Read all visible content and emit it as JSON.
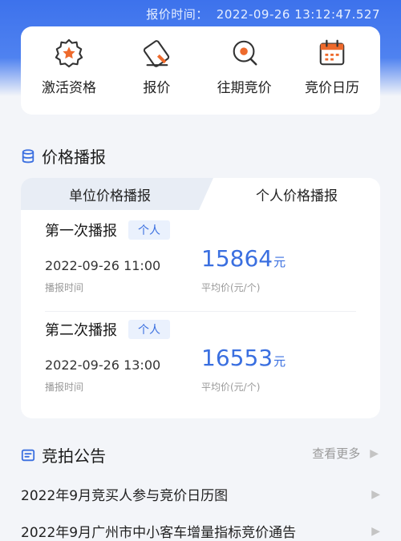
{
  "header": {
    "time_label": "报价时间：",
    "time_value": "2022-09-26 13:12:47.527"
  },
  "quick_links": [
    {
      "label": "激活资格",
      "icon": "badge-star-icon"
    },
    {
      "label": "报价",
      "icon": "pen-edit-icon"
    },
    {
      "label": "往期竞价",
      "icon": "search-history-icon"
    },
    {
      "label": "竞价日历",
      "icon": "calendar-icon"
    }
  ],
  "price_section": {
    "title": "价格播报",
    "tabs": [
      "单位价格播报",
      "个人价格播报"
    ],
    "active_tab": 1,
    "records": [
      {
        "title": "第一次播报",
        "tag": "个人",
        "time": "2022-09-26 11:00",
        "time_label": "播报时间",
        "price": "15864",
        "unit": "元",
        "price_label": "平均价(元/个)"
      },
      {
        "title": "第二次播报",
        "tag": "个人",
        "time": "2022-09-26 13:00",
        "time_label": "播报时间",
        "price": "16553",
        "unit": "元",
        "price_label": "平均价(元/个)"
      }
    ]
  },
  "notice_section": {
    "title": "竞拍公告",
    "more": "查看更多",
    "items": [
      "2022年9月竞买人参与竞价日历图",
      "2022年9月广州市中小客车增量指标竞价通告"
    ]
  },
  "colors": {
    "accent": "#3a6fe0",
    "orange": "#ee6a2c",
    "banner": "#3d72ec"
  }
}
